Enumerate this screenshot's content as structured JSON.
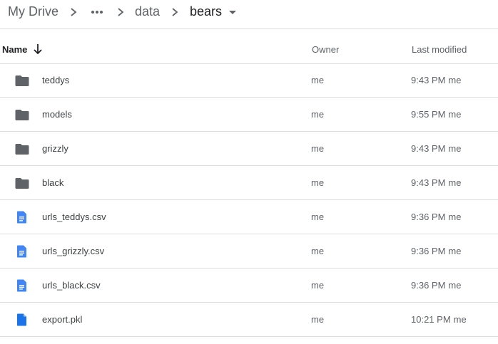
{
  "breadcrumb": {
    "root": "My Drive",
    "more": "•••",
    "data": "data",
    "current": "bears"
  },
  "header": {
    "name": "Name",
    "owner": "Owner",
    "last_modified": "Last modified"
  },
  "colors": {
    "folder": "#5f6368",
    "doc": "#4285f4",
    "file": "#1a73e8",
    "divider": "#dadce0"
  },
  "files": [
    {
      "type": "folder",
      "icon": "folder-icon",
      "name": "teddys",
      "owner": "me",
      "time": "9:43 PM",
      "by": "me"
    },
    {
      "type": "folder",
      "icon": "folder-icon",
      "name": "models",
      "owner": "me",
      "time": "9:55 PM",
      "by": "me"
    },
    {
      "type": "folder",
      "icon": "folder-icon",
      "name": "grizzly",
      "owner": "me",
      "time": "9:43 PM",
      "by": "me"
    },
    {
      "type": "folder",
      "icon": "folder-icon",
      "name": "black",
      "owner": "me",
      "time": "9:43 PM",
      "by": "me"
    },
    {
      "type": "doc",
      "icon": "document-icon",
      "name": "urls_teddys.csv",
      "owner": "me",
      "time": "9:36 PM",
      "by": "me"
    },
    {
      "type": "doc",
      "icon": "document-icon",
      "name": "urls_grizzly.csv",
      "owner": "me",
      "time": "9:36 PM",
      "by": "me"
    },
    {
      "type": "doc",
      "icon": "document-icon",
      "name": "urls_black.csv",
      "owner": "me",
      "time": "9:36 PM",
      "by": "me"
    },
    {
      "type": "file",
      "icon": "file-icon",
      "name": "export.pkl",
      "owner": "me",
      "time": "10:21 PM",
      "by": "me"
    }
  ]
}
